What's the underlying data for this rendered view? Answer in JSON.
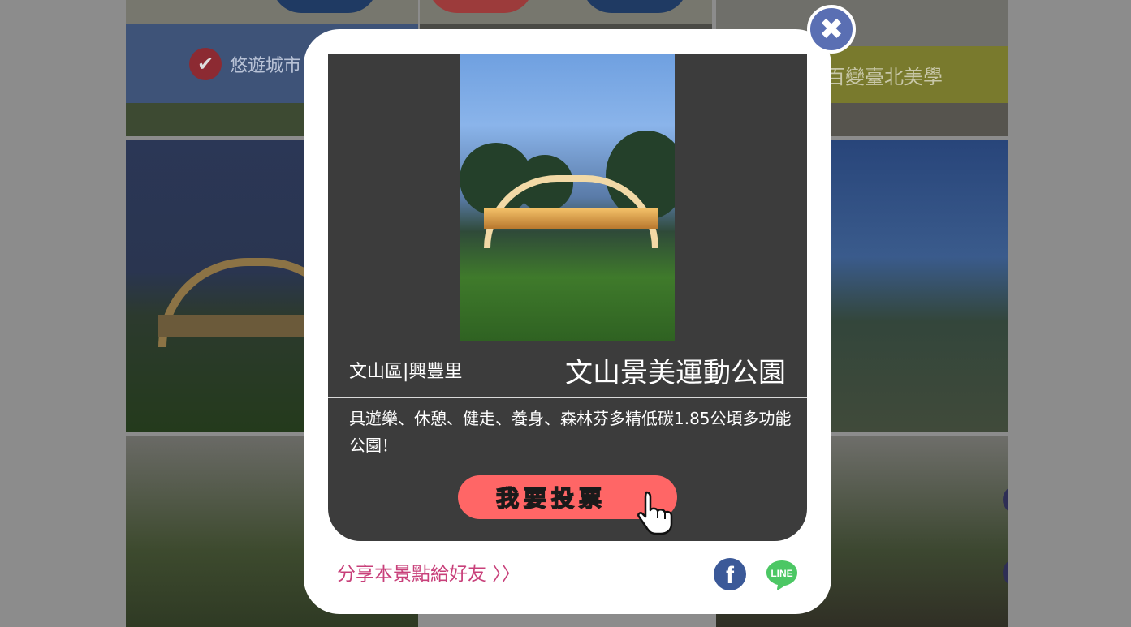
{
  "background": {
    "banner_left_text": "悠遊城市",
    "banner_right_text": "百變臺北美學"
  },
  "modal": {
    "close_icon": "close-x-icon",
    "photo_description": "arch-park-dusk",
    "district": "文山區|興豐里",
    "title": "文山景美運動公園",
    "description": "具遊樂、休憩、健走、養身、森林芬多精低碳1.85公頃多功能公園！",
    "vote_button_label": "我要投票",
    "share_text": "分享本景點給好友 〉〉",
    "share_icons": [
      "facebook-icon",
      "line-icon"
    ],
    "facebook_glyph": "f",
    "line_glyph": "LINE"
  },
  "colors": {
    "overlay_bg": "#8c8c8c",
    "card_bg": "#3c3c3c",
    "vote_button": "#ff6666",
    "share_text": "#c8407a",
    "close_button": "#5a6fb3",
    "facebook": "#3b5998",
    "line": "#4cc764"
  }
}
